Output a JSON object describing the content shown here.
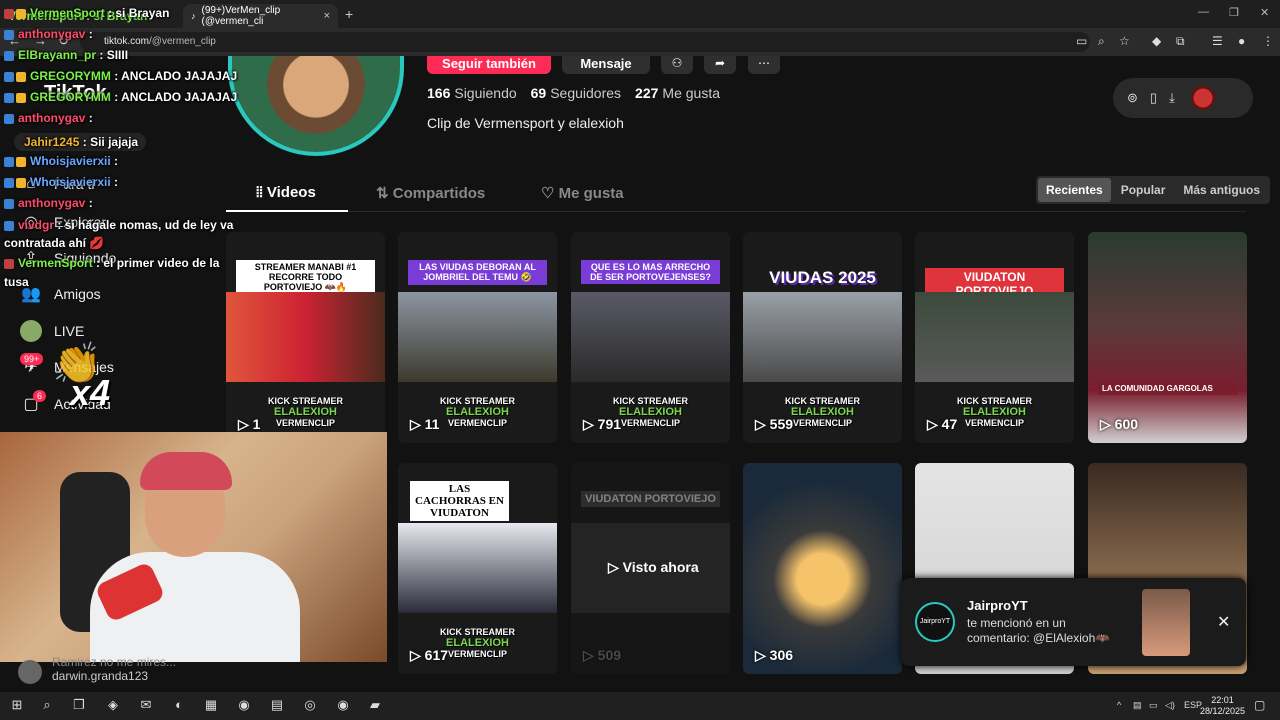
{
  "browser": {
    "tab1_title": "VermenSport : si Brayan",
    "tab2_title": "(99+)VerMen_clip (@vermen_cli",
    "tab_close": "×",
    "new_tab": "+",
    "url_host": "tiktok.com",
    "url_path": "/@vermen_clip"
  },
  "tiktok": {
    "logo": "TikTok",
    "sidebar": [
      {
        "label": "Para ti",
        "icon": "home-icon"
      },
      {
        "label": "Explorar",
        "icon": "compass-icon"
      },
      {
        "label": "Siguiendo",
        "icon": "following-icon"
      },
      {
        "label": "Amigos",
        "icon": "friends-icon"
      },
      {
        "label": "LIVE",
        "icon": "live-icon"
      },
      {
        "label": "Mensajes",
        "icon": "messages-icon",
        "badge": "99+"
      },
      {
        "label": "Actividad",
        "icon": "activity-icon",
        "badge": "6"
      }
    ],
    "profile": {
      "follow_back": "Seguir también",
      "message": "Mensaje",
      "following_count": "166",
      "following_label": "Siguiendo",
      "followers_count": "69",
      "followers_label": "Seguidores",
      "likes_count": "227",
      "likes_label": "Me gusta",
      "bio": "Clip de Vermensport y elalexioh"
    },
    "tabs": [
      "Videos",
      "Compartidos",
      "Me gusta"
    ],
    "sort": [
      "Recientes",
      "Popular",
      "Más antiguos"
    ],
    "videos": [
      {
        "caption": "STREAMER MANABI #1 RECORRE TODO PORTOVIEJO 🦇🔥",
        "views": "1"
      },
      {
        "caption": "LAS VIUDAS DEBORAN AL JOMBRIEL DEL TEMU 🤣",
        "views": "11"
      },
      {
        "caption": "QUE ES LO MAS ARRECHO DE SER PORTOVEJENSES?",
        "views": "791"
      },
      {
        "caption": "VIUDAS 2025",
        "views": "559"
      },
      {
        "caption": "VIUDATON PORTOVIEJO",
        "views": "47"
      },
      {
        "caption": "LA COMUNIDAD GARGOLAS",
        "views": "600"
      },
      {
        "caption": "",
        "views": ""
      },
      {
        "caption": "LAS CACHORRAS EN VIUDATON",
        "views": "617"
      },
      {
        "caption": "VIUDATON PORTOVIEJO",
        "views": "509",
        "overlay": "Visto ahora"
      },
      {
        "caption": "",
        "views": "306"
      }
    ],
    "brand_top": "KICK STREAMER",
    "brand_mid": "ELALEXIOH",
    "brand_bot": "VERMENCLIP"
  },
  "notification": {
    "user": "JairproYT",
    "message": "te mencionó en un comentario: @ElAlexioh🦇",
    "avatar_text": "JairproYT"
  },
  "chat": [
    {
      "user": "VermenSport",
      "text": ": si Brayan",
      "color": "#7cf04a"
    },
    {
      "user": "anthonygav",
      "text": ":",
      "color": "#ff4a6a"
    },
    {
      "user": "ElBrayann_pr",
      "text": ": SIIII",
      "color": "#7cf04a"
    },
    {
      "user": "GREGORYMM",
      "text": ": ANCLADO JAJAJAJ",
      "color": "#7cf04a"
    },
    {
      "user": "GREGORYMM",
      "text": ": ANCLADO JAJAJAJ",
      "color": "#7cf04a"
    },
    {
      "user": "anthonygav",
      "text": ":",
      "color": "#ff4a6a"
    },
    {
      "user": "Jahir1245",
      "text": ": Sii jajaja",
      "color": "#f0b52c"
    },
    {
      "user": "Whoisjavierxii",
      "text": ":",
      "color": "#6aa8ff"
    },
    {
      "user": "Whoisjavierxii",
      "text": ":",
      "color": "#6aa8ff"
    },
    {
      "user": "anthonygav",
      "text": ":",
      "color": "#ff4a6a"
    },
    {
      "user": "vivdgr",
      "text": ": si hágale nomas, ud de ley va",
      "color": "#ff4a6a"
    },
    {
      "user": "",
      "text": "contratada ahí 💋",
      "color": "#ffffff"
    },
    {
      "user": "VermenSport",
      "text": ": el primer video de la",
      "color": "#7cf04a"
    },
    {
      "user": "",
      "text": "tusa",
      "color": "#ffffff"
    }
  ],
  "below_cam": {
    "line1": "Ramirez no me mires...",
    "line2": "darwin.granda123"
  },
  "overlay_multiplier": "x4",
  "taskbar": {
    "time": "22:01",
    "date": "28/12/2025",
    "lang": "ESP"
  }
}
